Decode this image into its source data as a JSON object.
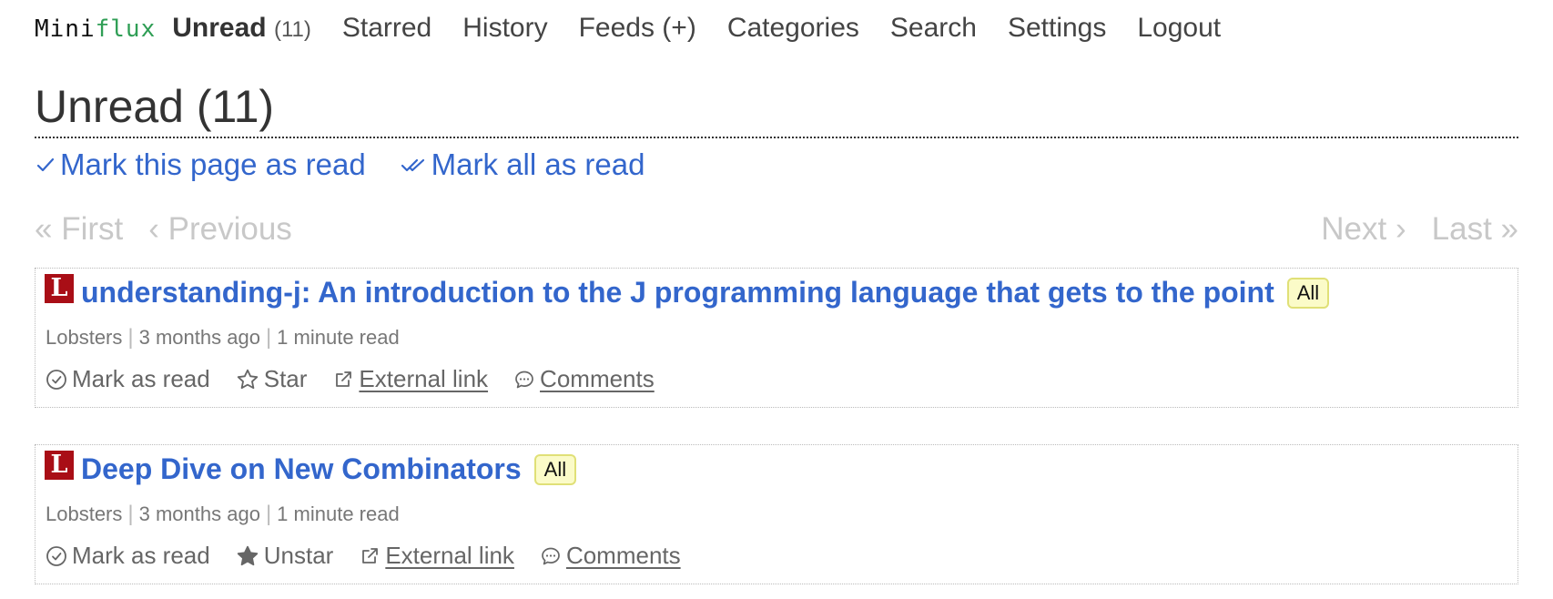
{
  "logo": {
    "part1": "Mini",
    "part2": "flux"
  },
  "nav": {
    "unread_label": "Unread",
    "unread_count": "(11)",
    "starred": "Starred",
    "history": "History",
    "feeds": "Feeds (+)",
    "categories": "Categories",
    "search": "Search",
    "settings": "Settings",
    "logout": "Logout"
  },
  "page": {
    "title": "Unread (11)",
    "mark_page_read": "Mark this page as read",
    "mark_all_read": "Mark all as read"
  },
  "pagination": {
    "first": "« First",
    "previous": "‹ Previous",
    "next": "Next ›",
    "last": "Last »"
  },
  "entries": [
    {
      "favicon": "L",
      "title": "understanding-j: An introduction to the J programming language that gets to the point",
      "category": "All",
      "feed": "Lobsters",
      "date": "3 months ago",
      "reading_time": "1 minute read",
      "mark_read": "Mark as read",
      "star": "Star",
      "starred": false,
      "external": "External link",
      "comments": "Comments"
    },
    {
      "favicon": "L",
      "title": "Deep Dive on New Combinators",
      "category": "All",
      "feed": "Lobsters",
      "date": "3 months ago",
      "reading_time": "1 minute read",
      "mark_read": "Mark as read",
      "star": "Unstar",
      "starred": true,
      "external": "External link",
      "comments": "Comments"
    }
  ],
  "colors": {
    "link": "#3366cc",
    "logo_accent": "#2f9e55",
    "favicon_bg": "#a90e16",
    "badge_bg": "#fbfbc8",
    "disabled": "#c8c8c8"
  }
}
